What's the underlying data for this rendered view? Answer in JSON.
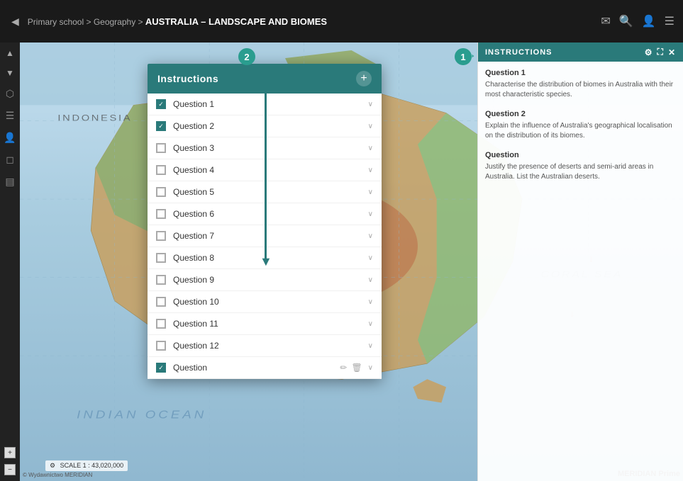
{
  "topbar": {
    "breadcrumb": {
      "level1": "Primary school",
      "separator1": " > ",
      "level2": "Geography",
      "separator2": " > ",
      "level3": "AUSTRALIA – LANDSCAPE AND BIOMES"
    },
    "icons": {
      "mail": "✉",
      "search": "🔍",
      "user": "👤",
      "menu": "☰"
    }
  },
  "sidebar": {
    "nav_up": "▲",
    "nav_down": "▼",
    "icons": [
      "⬡",
      "☰",
      "👤",
      "◻",
      "☰"
    ]
  },
  "instructions_modal": {
    "title": "Instructions",
    "add_button": "+",
    "questions": [
      {
        "id": 1,
        "label": "Question 1",
        "checked": true
      },
      {
        "id": 2,
        "label": "Question 2",
        "checked": true
      },
      {
        "id": 3,
        "label": "Question 3",
        "checked": false
      },
      {
        "id": 4,
        "label": "Question 4",
        "checked": false
      },
      {
        "id": 5,
        "label": "Question 5",
        "checked": false
      },
      {
        "id": 6,
        "label": "Question 6",
        "checked": false
      },
      {
        "id": 7,
        "label": "Question 7",
        "checked": false
      },
      {
        "id": 8,
        "label": "Question 8",
        "checked": false
      },
      {
        "id": 9,
        "label": "Question 9",
        "checked": false
      },
      {
        "id": 10,
        "label": "Question 10",
        "checked": false
      },
      {
        "id": 11,
        "label": "Question 11",
        "checked": false
      },
      {
        "id": 12,
        "label": "Question 12",
        "checked": false
      },
      {
        "id": 13,
        "label": "Question",
        "checked": true,
        "has_actions": true
      }
    ]
  },
  "right_panel": {
    "header": "INSTRUCTIONS",
    "settings_icon": "⚙",
    "expand_icon": "⛶",
    "close_icon": "✕",
    "questions": [
      {
        "title": "Question 1",
        "text": "Characterise the distribution of biomes in Australia with their most characteristic species."
      },
      {
        "title": "Question 2",
        "text": "Explain the influence of Australia's geographical localisation on the distribution of its biomes."
      },
      {
        "title": "Question",
        "text": "Justify the presence of deserts and semi-arid areas in Australia. List the Australian deserts."
      }
    ]
  },
  "map": {
    "copyright": "© Wydawnictwo MERIDIAN",
    "scale": "SCALE  1 : 43,020,000",
    "watermark": "MERIDIAN Prime",
    "labels": {
      "indonesia": "INDONESIA",
      "indian_ocean": "INDIAN   OCEAN",
      "ocean_bottom": "INDIAN   OCEAN"
    }
  },
  "badges": {
    "badge1": "1",
    "badge2": "2"
  }
}
